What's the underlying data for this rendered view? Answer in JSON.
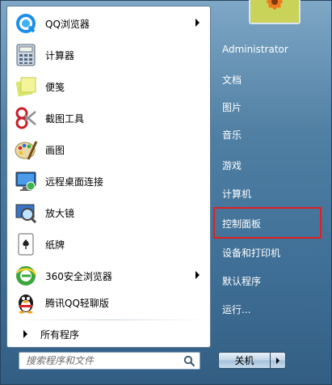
{
  "programs": [
    {
      "label": "QQ浏览器",
      "icon": "qq-browser-icon",
      "has_submenu": true
    },
    {
      "label": "计算器",
      "icon": "calculator-icon",
      "has_submenu": false
    },
    {
      "label": "便笺",
      "icon": "sticky-notes-icon",
      "has_submenu": false
    },
    {
      "label": "截图工具",
      "icon": "snipping-tool-icon",
      "has_submenu": false
    },
    {
      "label": "画图",
      "icon": "paint-icon",
      "has_submenu": false
    },
    {
      "label": "远程桌面连接",
      "icon": "remote-desktop-icon",
      "has_submenu": false
    },
    {
      "label": "放大镜",
      "icon": "magnifier-icon",
      "has_submenu": false
    },
    {
      "label": "纸牌",
      "icon": "solitaire-icon",
      "has_submenu": false
    },
    {
      "label": "360安全浏览器",
      "icon": "360-browser-icon",
      "has_submenu": true
    },
    {
      "label": "腾讯QQ轻聊版",
      "icon": "qq-penguin-icon",
      "has_submenu": false
    }
  ],
  "all_programs": {
    "label": "所有程序"
  },
  "search": {
    "placeholder": "搜索程序和文件"
  },
  "right_items": [
    {
      "label": "Administrator"
    },
    {
      "label": "文档"
    },
    {
      "label": "图片"
    },
    {
      "label": "音乐"
    },
    {
      "label": "游戏"
    },
    {
      "label": "计算机"
    },
    {
      "label": "控制面板",
      "highlighted": true
    },
    {
      "label": "设备和打印机"
    },
    {
      "label": "默认程序"
    },
    {
      "label": "运行..."
    }
  ],
  "shutdown": {
    "label": "关机"
  },
  "colors": {
    "highlight_border": "#e12020",
    "menu_blue": "#3f6f96"
  }
}
